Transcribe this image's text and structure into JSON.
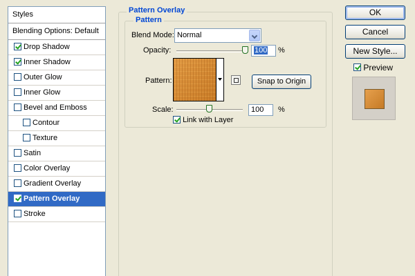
{
  "styles_panel": {
    "header": "Styles",
    "blending_options": "Blending Options: Default",
    "items": [
      {
        "label": "Drop Shadow",
        "checked": true
      },
      {
        "label": "Inner Shadow",
        "checked": true
      },
      {
        "label": "Outer Glow",
        "checked": false
      },
      {
        "label": "Inner Glow",
        "checked": false
      },
      {
        "label": "Bevel and Emboss",
        "checked": false
      },
      {
        "label": "Contour",
        "checked": false
      },
      {
        "label": "Texture",
        "checked": false
      },
      {
        "label": "Satin",
        "checked": false
      },
      {
        "label": "Color Overlay",
        "checked": false
      },
      {
        "label": "Gradient Overlay",
        "checked": false
      },
      {
        "label": "Pattern Overlay",
        "checked": true,
        "selected": true
      },
      {
        "label": "Stroke",
        "checked": false
      }
    ]
  },
  "pattern_overlay": {
    "title": "Pattern Overlay",
    "group_title": "Pattern",
    "blend_mode_label": "Blend Mode:",
    "blend_mode_value": "Normal",
    "opacity_label": "Opacity:",
    "opacity_value": "100",
    "opacity_unit": "%",
    "opacity_level": 1.0,
    "pattern_label": "Pattern:",
    "pattern_color": "#D4892E",
    "snap_button": "Snap to Origin",
    "scale_label": "Scale:",
    "scale_value": "100",
    "scale_unit": "%",
    "scale_level": 0.1,
    "link_with_layer_label": "Link with Layer",
    "link_with_layer_checked": true
  },
  "buttons": {
    "ok": "OK",
    "cancel": "Cancel",
    "new_style": "New Style...",
    "preview_label": "Preview",
    "preview_checked": true
  },
  "colors": {
    "dialog_bg": "#ECE9D8",
    "accent": "#316AC5",
    "group_title": "#0046D5"
  }
}
